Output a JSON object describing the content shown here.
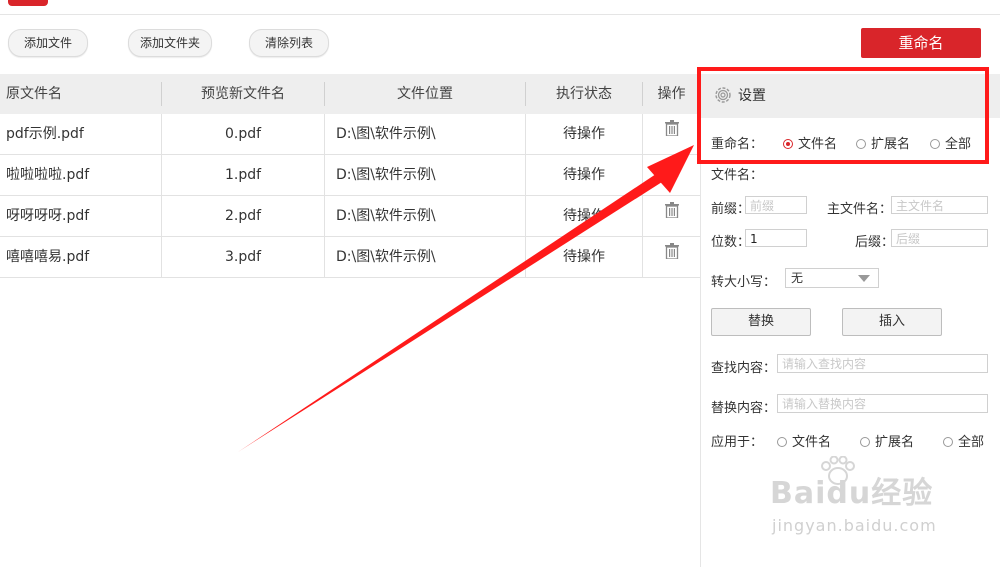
{
  "toolbar": {
    "add_file": "添加文件",
    "add_folder": "添加文件夹",
    "clear_list": "清除列表",
    "rename": "重命名"
  },
  "table": {
    "headers": [
      "原文件名",
      "预览新文件名",
      "文件位置",
      "执行状态",
      "操作"
    ],
    "rows": [
      {
        "original": "pdf示例.pdf",
        "preview": "0.pdf",
        "location": "D:\\图\\软件示例\\",
        "status": "待操作"
      },
      {
        "original": "啦啦啦啦.pdf",
        "preview": "1.pdf",
        "location": "D:\\图\\软件示例\\",
        "status": "待操作"
      },
      {
        "original": "呀呀呀呀.pdf",
        "preview": "2.pdf",
        "location": "D:\\图\\软件示例\\",
        "status": "待操作"
      },
      {
        "original": "嘻嘻嘻易.pdf",
        "preview": "3.pdf",
        "location": "D:\\图\\软件示例\\",
        "status": "待操作"
      }
    ],
    "delete_icon": "trash-icon"
  },
  "settings": {
    "title": "设置",
    "rename_label": "重命名：",
    "rename_options": [
      "文件名",
      "扩展名",
      "全部"
    ],
    "rename_selected": "文件名",
    "filename_label": "文件名：",
    "prefix_label": "前缀：",
    "prefix_placeholder": "前缀",
    "main_name_label": "主文件名：",
    "main_name_placeholder": "主文件名",
    "digits_label": "位数：",
    "digits_value": "1",
    "suffix_label": "后缀：",
    "suffix_placeholder": "后缀",
    "case_label": "转大小写：",
    "case_value": "无",
    "replace_button": "替换",
    "insert_button": "插入",
    "find_label": "查找内容：",
    "find_placeholder": "请输入查找内容",
    "replace_label": "替换内容：",
    "replace_placeholder": "请输入替换内容",
    "apply_label": "应用于：",
    "apply_options": [
      "文件名",
      "扩展名",
      "全部"
    ]
  },
  "watermark": {
    "main": "Baidu经验",
    "sub": "jingyan.baidu.com"
  },
  "colors": {
    "accent": "#d9252a",
    "annotation": "#ff1a1a",
    "header_bg": "#eeeeee"
  }
}
